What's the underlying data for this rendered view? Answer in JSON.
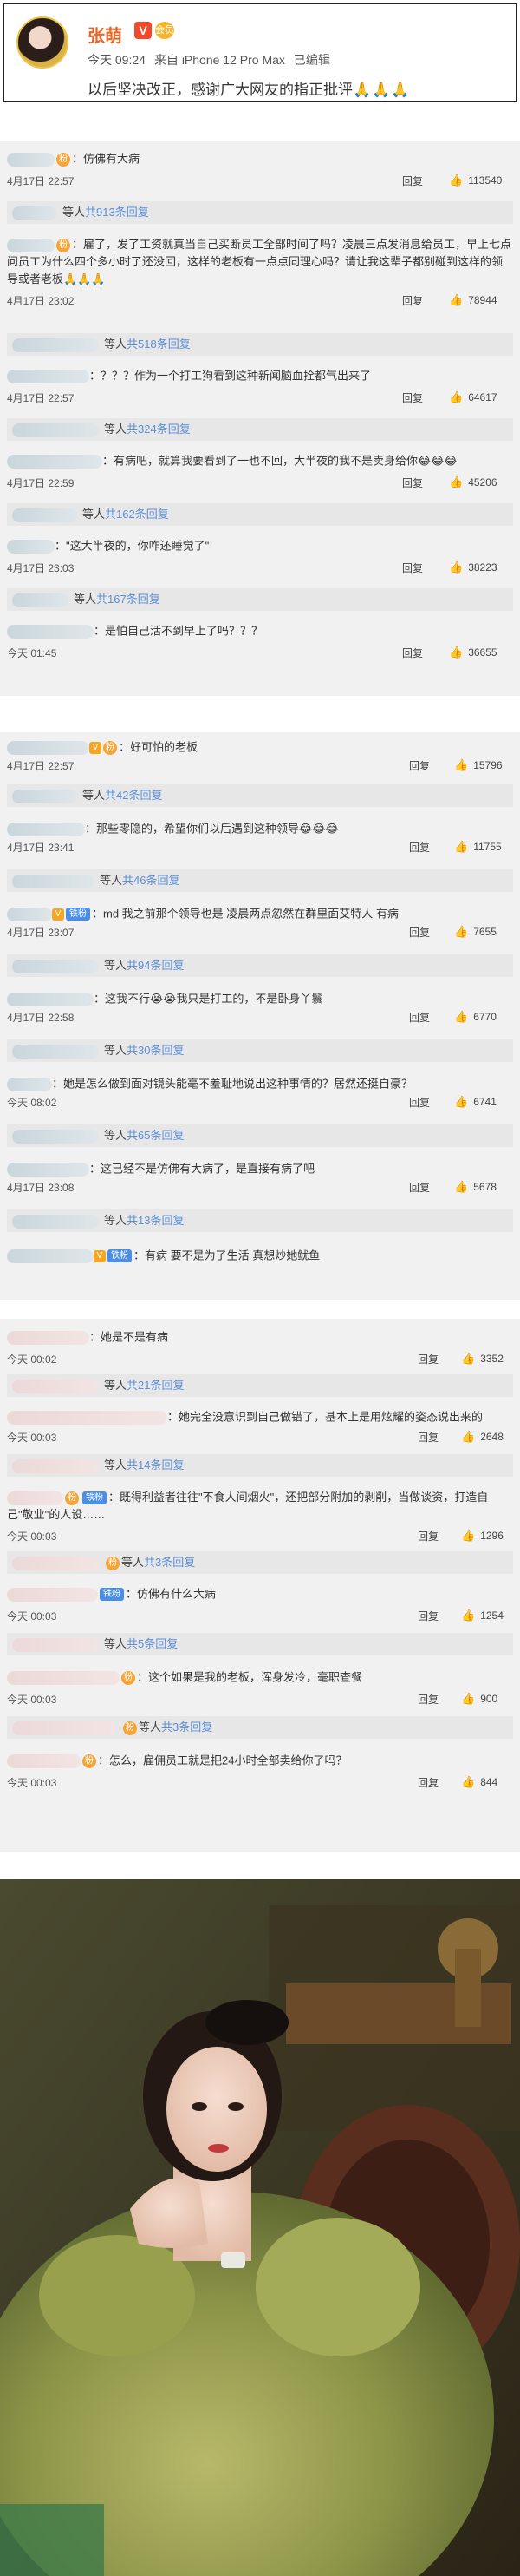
{
  "post": {
    "author": "张萌",
    "vip_mark": "V",
    "badge": "会员",
    "time": "今天 09:24",
    "source": "来自 iPhone 12 Pro Max",
    "edited": "已编辑",
    "text": "以后坚决改正，感谢广大网友的指正批评",
    "emoji": "🙏🙏🙏"
  },
  "labels": {
    "reply": "回复",
    "thumb": "👍"
  },
  "panel1": {
    "comments": [
      {
        "text": "：仿佛有大病",
        "date": "4月17日 22:57",
        "likes": "113540"
      },
      {
        "text": "：雇了，发了工资就真当自己买断员工全部时间了吗？凌晨三点发消息给员工，早上七点问员工为什么四个多小时了还没回，这样的老板有一点点同理心吗？请让我这辈子都别碰到这样的领导或者老板🙏🙏🙏",
        "date": "4月17日 23:02",
        "likes": "78944"
      },
      {
        "text": "：？？？作为一个打工狗看到这种新闻脑血拴都气出来了",
        "date": "4月17日 22:57",
        "likes": "64617"
      },
      {
        "text": "：有病吧，就算我要看到了一也不回，大半夜的我不是卖身给你😂😂😂",
        "date": "4月17日 22:59",
        "likes": "45206"
      },
      {
        "text": "：\"这大半夜的，你咋还睡觉了\"",
        "date": "4月17日 23:03",
        "likes": "38223"
      },
      {
        "text": "：是怕自己活不到早上了吗？？？",
        "date": "今天 01:45",
        "likes": "36655"
      }
    ],
    "replies": [
      {
        "pre": "等人",
        "count": "共913条回复"
      },
      {
        "pre": "等人",
        "count": "共518条回复"
      },
      {
        "pre": "等人",
        "count": "共324条回复"
      },
      {
        "pre": "等人",
        "count": "共162条回复"
      },
      {
        "pre": "等人",
        "count": "共167条回复"
      }
    ]
  },
  "panel2": {
    "comments": [
      {
        "text": "：好可怕的老板",
        "date": "4月17日 22:57",
        "likes": "15796"
      },
      {
        "text": "：那些零隐的，希望你们以后遇到这种领导😂😂😂",
        "date": "4月17日 23:41",
        "likes": "11755"
      },
      {
        "text": "：md 我之前那个领导也是 凌晨两点忽然在群里面艾特人 有病",
        "date": "4月17日 23:07",
        "likes": "7655"
      },
      {
        "text": "：这我不行😭😭我只是打工的，不是卧身丫鬟",
        "date": "4月17日 22:58",
        "likes": "6770"
      },
      {
        "text": "：她是怎么做到面对镜头能毫不羞耻地说出这种事情的？居然还挺自豪？",
        "date": "今天 08:02",
        "likes": "6741"
      },
      {
        "text": "：这已经不是仿佛有大病了，是直接有病了吧",
        "date": "4月17日 23:08",
        "likes": "5678"
      },
      {
        "text": "：有病 要不是为了生活 真想炒她鱿鱼"
      }
    ],
    "replies": [
      {
        "pre": "等人",
        "count": "共42条回复"
      },
      {
        "pre": "等人",
        "count": "共46条回复"
      },
      {
        "pre": "等人",
        "count": "共94条回复"
      },
      {
        "pre": "等人",
        "count": "共30条回复"
      },
      {
        "pre": "等人",
        "count": "共65条回复"
      },
      {
        "pre": "等人",
        "count": "共13条回复"
      }
    ]
  },
  "panel3": {
    "comments": [
      {
        "text": "：她是不是有病",
        "date": "今天 00:02",
        "likes": "3352"
      },
      {
        "text": "：她完全没意识到自己做错了，基本上是用炫耀的姿态说出来的",
        "date": "今天 00:03",
        "likes": "2648"
      },
      {
        "text": "：既得利益者往往\"不食人间烟火\"，还把部分附加的剥削，当做谈资，打造自己\"敬业\"的人设……",
        "date": "今天 00:03",
        "likes": "1296"
      },
      {
        "text": "：仿佛有什么大病",
        "date": "今天 00:03",
        "likes": "1254"
      },
      {
        "text": "：这个如果是我的老板，浑身发冷，毫职查餐",
        "date": "今天 00:03",
        "likes": "900"
      },
      {
        "text": "：怎么，雇佣员工就是把24小时全部卖给你了吗？",
        "date": "今天 00:03",
        "likes": "844"
      }
    ],
    "replies": [
      {
        "pre": "等人",
        "count": "共21条回复"
      },
      {
        "pre": "等人",
        "count": "共14条回复"
      },
      {
        "pre": "等人",
        "count": "共3条回复"
      },
      {
        "pre": "等人",
        "count": "共5条回复"
      },
      {
        "pre": "等人",
        "count": "共3条回复"
      }
    ]
  },
  "colors": {
    "panel_bg": "#f1f1f1",
    "reply_count": "#5b8fd8",
    "author_name": "#e2672a"
  }
}
